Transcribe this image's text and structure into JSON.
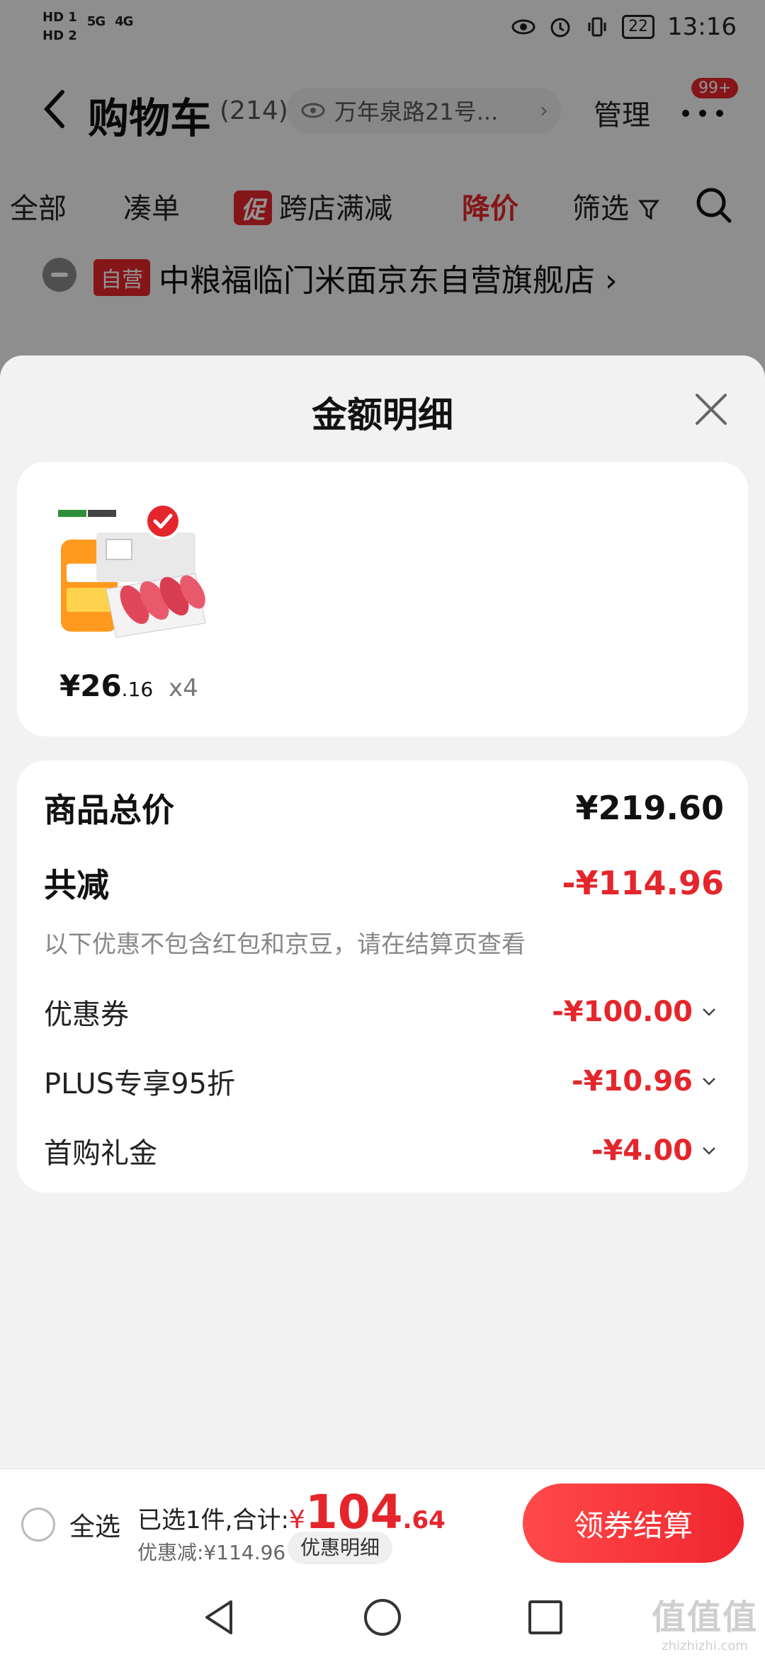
{
  "status_bar": {
    "hd1": "HD 1",
    "hd2": "HD 2",
    "network1": "5G",
    "network2": "4G",
    "battery": "22",
    "time": "13:16"
  },
  "nav": {
    "title": "购物车",
    "count": "(214)",
    "address": "万年泉路21号...",
    "manage": "管理",
    "badge": "99+"
  },
  "filters": [
    {
      "label": "全部"
    },
    {
      "label": "凑单"
    },
    {
      "label": "跨店满减",
      "tag": "促"
    },
    {
      "label": "降价"
    },
    {
      "label": "筛选"
    }
  ],
  "shop": {
    "tag": "自营",
    "name": "中粮福临门米面京东自营旗舰店 ›"
  },
  "sheet": {
    "title": "金额明细",
    "product": {
      "price_main": "¥26",
      "price_decimal": ".16",
      "quantity": "x4"
    },
    "total_label": "商品总价",
    "total_value": "¥219.60",
    "reduce_label": "共减",
    "reduce_value": "-¥114.96",
    "note": "以下优惠不包含红包和京豆，请在结算页查看",
    "discounts": [
      {
        "label": "优惠券",
        "value": "-¥100.00"
      },
      {
        "label": "PLUS专享95折",
        "value": "-¥10.96"
      },
      {
        "label": "首购礼金",
        "value": "-¥4.00"
      }
    ]
  },
  "bottom_bar": {
    "select_all": "全选",
    "selected_text": "已选1件,合计:",
    "currency": "¥",
    "total_int": "104",
    "total_dec": ".64",
    "discount_text": "优惠减:¥114.96",
    "detail_button": "优惠明细",
    "checkout_button": "领券结算"
  },
  "watermark": {
    "main": "值值值",
    "sub": "zhizhizhi.com"
  },
  "colors": {
    "accent_red": "#e4262c",
    "sheet_bg": "#f2f2f2",
    "card_bg": "#ffffff"
  },
  "icons": [
    "back-icon",
    "eye-icon",
    "more-icon",
    "filter-icon",
    "search-icon",
    "close-icon",
    "check-icon",
    "chevron-down-icon",
    "nav-back-icon",
    "nav-home-icon",
    "nav-recent-icon"
  ]
}
